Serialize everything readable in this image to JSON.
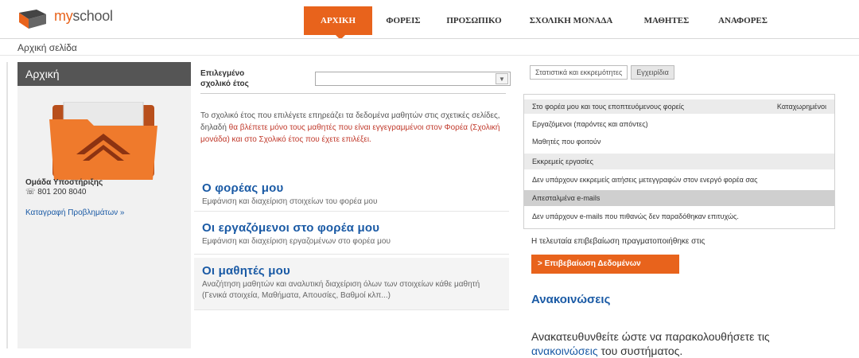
{
  "header": {
    "logo_text": "myschool",
    "logo_prefix": "my",
    "logo_suffix": "school",
    "nav": [
      {
        "label": "ΑΡΧΙΚΗ",
        "active": true
      },
      {
        "label": "ΦΟΡΕΙΣ",
        "active": false
      },
      {
        "label": "ΠΡΟΣΩΠΙΚΟ",
        "active": false
      },
      {
        "label": "ΣΧΟΛΙΚΗ ΜΟΝΑΔΑ",
        "active": false
      },
      {
        "label": "ΜΑΘΗΤΕΣ",
        "active": false
      },
      {
        "label": "ΑΝΑΦΟΡΕΣ",
        "active": false
      }
    ],
    "accent_color": "#e8631c"
  },
  "breadcrumb": "Αρχική σελίδα",
  "sidebar": {
    "title": "Αρχική",
    "icon": "folder-home-icon",
    "support_label": "Ομάδα Υποστήριξης",
    "support_phone": "801 200 8040",
    "report_link": "Καταγραφή Προβλημάτων »"
  },
  "main": {
    "year_label_1": "Επιλεγμένο",
    "year_label_2": "σχολικό έτος",
    "year_value": "",
    "info_part1": "Το σχολικό έτος που επιλέγετε επηρεάζει τα δεδομένα μαθητών στις σχετικές σελίδες, δηλαδή ",
    "info_highlight": "θα βλέπετε μόνο τους μαθητές που είναι εγγεγραμμένοι στον Φορέα (Σχολική μονάδα) και στο Σχολικό έτος που έχετε επιλέξει.",
    "cards": [
      {
        "title": "Ο φορέας μου",
        "desc": "Εμφάνιση και διαχείριση στοιχείων του φορέα μου"
      },
      {
        "title": "Οι εργαζόμενοι στο φορέα μου",
        "desc": "Εμφάνιση και διαχείριση εργαζομένων στο φορέα μου"
      },
      {
        "title": "Οι μαθητές μου",
        "desc": "Αναζήτηση μαθητών και αναλυτική διαχείριση όλων των στοιχείων κάθε μαθητή (Γενικά στοιχεία, Μαθήματα, Απουσίες, Βαθμοί κλπ...)"
      }
    ]
  },
  "right": {
    "tabs": [
      "Στατιστικά και εκκρεμότητες",
      "Εγχειρίδια"
    ],
    "rows": [
      {
        "text": "Στο φορέα μου και τους εποπτευόμενους φορείς",
        "right": "Καταχωρημένοι"
      },
      {
        "text": "Εργαζόμενοι (παρόντες και απόντες)"
      },
      {
        "text": "Μαθητές που φοιτούν"
      },
      {
        "text": "Εκκρεμείς εργασίες"
      },
      {
        "text": "Δεν υπάρχουν εκκρεμείς αιτήσεις μετεγγραφών στον ενεργό φορέα σας"
      },
      {
        "text": "Απεσταλμένα e-mails"
      },
      {
        "text": "Δεν υπάρχουν e-mails που πιθανώς δεν παραδόθηκαν επιτυχώς."
      }
    ],
    "last_confirm": "Η τελευταία επιβεβαίωση πραγματοποιήθηκε στις",
    "confirm_button": "> Επιβεβαίωση Δεδομένων",
    "announcements_title": "Ανακοινώσεις",
    "ann_text_1": "Ανακατευθυνθείτε ώστε να παρακολουθήσετε τις",
    "ann_link": "ανακοινώσεις",
    "ann_text_2": " του συστήματος."
  }
}
